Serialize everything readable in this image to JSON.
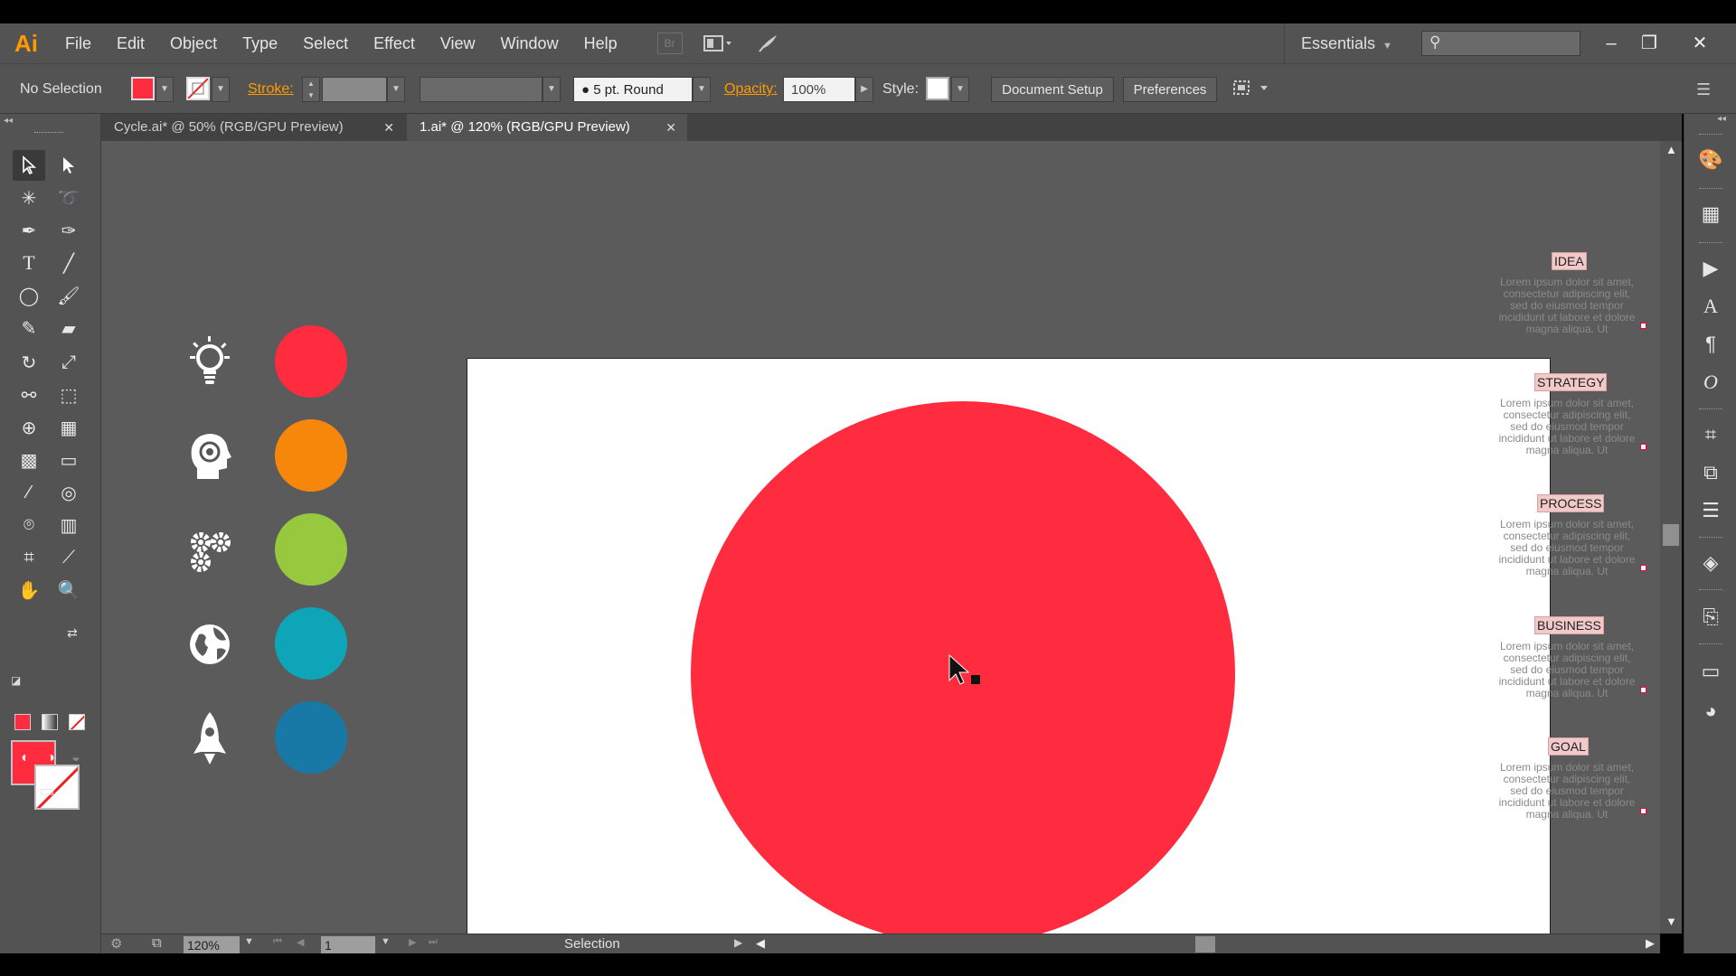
{
  "app": {
    "logo": "Ai"
  },
  "menu": {
    "items": [
      "File",
      "Edit",
      "Object",
      "Type",
      "Select",
      "Effect",
      "View",
      "Window",
      "Help"
    ],
    "bridge_label": "Br",
    "workspace": "Essentials"
  },
  "controlbar": {
    "selection": "No Selection",
    "stroke_label": "Stroke:",
    "brush": "5 pt. Round",
    "opacity_label": "Opacity:",
    "opacity_value": "100%",
    "style_label": "Style:",
    "doc_setup": "Document Setup",
    "preferences": "Preferences",
    "fill_color": "#ff2b3e"
  },
  "tabs": [
    {
      "label": "Cycle.ai* @ 50% (RGB/GPU Preview)",
      "active": false
    },
    {
      "label": "1.ai* @ 120% (RGB/GPU Preview)",
      "active": true
    }
  ],
  "artboard": {
    "main_circle_color": "#ff2b3e",
    "dots": [
      {
        "color": "#ff2b3e",
        "icon": "lightbulb-icon"
      },
      {
        "color": "#f7870a",
        "icon": "head-target-icon"
      },
      {
        "color": "#97c93f",
        "icon": "gears-icon"
      },
      {
        "color": "#0ea5b8",
        "icon": "globe-icon"
      },
      {
        "color": "#1879a6",
        "icon": "rocket-icon"
      }
    ]
  },
  "pasteboard": {
    "sections": [
      {
        "title": "IDEA",
        "body": "Lorem ipsum dolor sit amet, consectetur adipiscing elit, sed do eiusmod tempor incididunt ut labore et dolore magna aliqua. Ut"
      },
      {
        "title": "STRATEGY",
        "body": "Lorem ipsum dolor sit amet, consectetur adipiscing elit, sed do eiusmod tempor incididunt ut labore et dolore magna aliqua. Ut"
      },
      {
        "title": "PROCESS",
        "body": "Lorem ipsum dolor sit amet, consectetur adipiscing elit, sed do eiusmod tempor incididunt ut labore et dolore magna aliqua. Ut"
      },
      {
        "title": "BUSINESS",
        "body": "Lorem ipsum dolor sit amet, consectetur adipiscing elit, sed do eiusmod tempor incididunt ut labore et dolore magna aliqua. Ut"
      },
      {
        "title": "GOAL",
        "body": "Lorem ipsum dolor sit amet, consectetur adipiscing elit, sed do eiusmod tempor incididunt ut labore et dolore magna aliqua. Ut"
      }
    ]
  },
  "statusbar": {
    "zoom": "120%",
    "page": "1",
    "tool": "Selection"
  }
}
